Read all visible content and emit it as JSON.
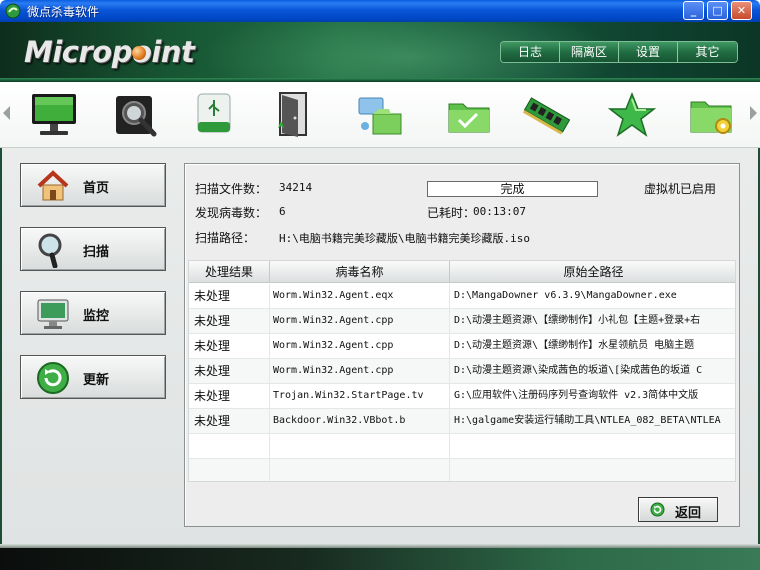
{
  "window": {
    "title": "微点杀毒软件",
    "buttons": {
      "minimize": "_",
      "maximize": "□",
      "close": "✕"
    }
  },
  "header": {
    "logo_text": "Micropoint",
    "nav": [
      {
        "label": "日志"
      },
      {
        "label": "隔离区"
      },
      {
        "label": "设置"
      },
      {
        "label": "其它"
      }
    ]
  },
  "toolbar": {
    "icons": [
      "monitor-icon",
      "scan-disk-icon",
      "usb-drive-icon",
      "door-icon",
      "network-folder-icon",
      "folder-check-icon",
      "memory-icon",
      "star-icon",
      "folder-settings-icon"
    ]
  },
  "sidebar": {
    "items": [
      {
        "label": "首页",
        "icon": "home-icon"
      },
      {
        "label": "扫描",
        "icon": "magnifier-icon"
      },
      {
        "label": "监控",
        "icon": "monitor-icon"
      },
      {
        "label": "更新",
        "icon": "refresh-icon"
      }
    ]
  },
  "scan": {
    "files_label": "扫描文件数：",
    "files_value": "34214",
    "viruses_label": "发现病毒数：",
    "viruses_value": "6",
    "path_label": "扫描路径：",
    "path_value": "H:\\电脑书籍完美珍藏版\\电脑书籍完美珍藏版.iso",
    "progress_text": "完成",
    "progress_fraction": 1.0,
    "elapsed_label": "已耗时：",
    "elapsed_value": "00:13:07",
    "vm_status": "虚拟机已启用"
  },
  "results": {
    "columns": [
      "处理结果",
      "病毒名称",
      "原始全路径"
    ],
    "rows": [
      [
        "未处理",
        "Worm.Win32.Agent.eqx",
        "D:\\MangaDowner v6.3.9\\MangaDowner.exe"
      ],
      [
        "未处理",
        "Worm.Win32.Agent.cpp",
        "D:\\动漫主题资源\\【缥缈制作】小礼包【主题+登录+右"
      ],
      [
        "未处理",
        "Worm.Win32.Agent.cpp",
        "D:\\动漫主题资源\\【缥缈制作】水星领航员 电脑主题"
      ],
      [
        "未处理",
        "Worm.Win32.Agent.cpp",
        "D:\\动漫主题资源\\染成茜色的坂道\\[染成茜色的坂道 C"
      ],
      [
        "未处理",
        "Trojan.Win32.StartPage.tv",
        "G:\\应用软件\\注册码序列号查询软件 v2.3简体中文版"
      ],
      [
        "未处理",
        "Backdoor.Win32.VBbot.b",
        "H:\\galgame安装运行辅助工具\\NTLEA_082_BETA\\NTLEA"
      ]
    ]
  },
  "actions": {
    "back_label": "返回"
  }
}
